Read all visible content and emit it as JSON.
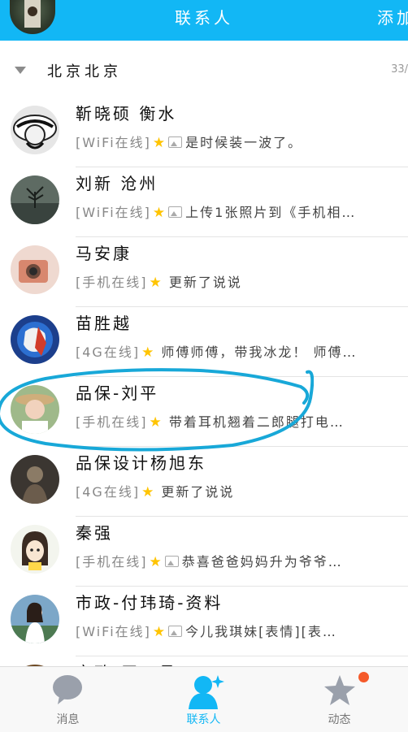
{
  "header": {
    "title": "联系人",
    "add_label": "添加"
  },
  "group": {
    "name": "北京北京",
    "count": "33/"
  },
  "contacts": [
    {
      "name": "靳晓硕 衡水",
      "online": "[WiFi在线]",
      "has_pic": true,
      "message": "是时候装一波了。"
    },
    {
      "name": "刘新 沧州",
      "online": "[WiFi在线]",
      "has_pic": true,
      "message": "上传1张照片到《手机相…"
    },
    {
      "name": "马安康",
      "online": "[手机在线]",
      "has_pic": false,
      "message": "更新了说说"
    },
    {
      "name": "苗胜越",
      "online": "[4G在线]",
      "has_pic": false,
      "message": "师傅师傅，带我冰龙！ 师傅…"
    },
    {
      "name": "品保-刘平",
      "online": "[手机在线]",
      "has_pic": false,
      "message": "带着耳机翘着二郎腿打电…"
    },
    {
      "name": "品保设计杨旭东",
      "online": "[4G在线]",
      "has_pic": false,
      "message": "更新了说说"
    },
    {
      "name": "秦强",
      "online": "[手机在线]",
      "has_pic": true,
      "message": "恭喜爸爸妈妈升为爷爷…"
    },
    {
      "name": "市政-付玮琦-资料",
      "online": "[WiFi在线]",
      "has_pic": true,
      "message": "今儿我琪妹[表情][表…"
    },
    {
      "name": "市政-王二月",
      "online": "",
      "has_pic": false,
      "message": ""
    }
  ],
  "tabs": [
    {
      "label": "消息",
      "icon": "chat-bubble-icon",
      "active": false
    },
    {
      "label": "联系人",
      "icon": "contacts-person-icon",
      "active": true
    },
    {
      "label": "动态",
      "icon": "star-icon",
      "active": false
    }
  ],
  "colors": {
    "accent": "#12b7f5",
    "star": "#ffc400",
    "annotation": "#18a8d8",
    "badge": "#f55a2a"
  }
}
